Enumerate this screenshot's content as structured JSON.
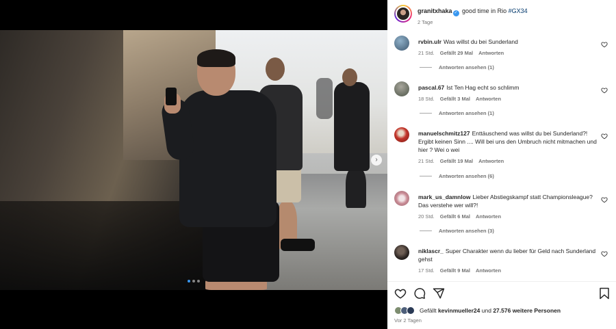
{
  "post": {
    "username": "granitxhaka",
    "caption_text": "good time in Rio",
    "hashtag": "#GX34",
    "age": "2 Tage"
  },
  "carousel": {
    "slide_count": 3,
    "active_slide": 1
  },
  "comments": [
    {
      "user": "rvbin.ulr",
      "text": "Was willst du bei Sunderland",
      "time": "21 Std.",
      "likes": "Gefällt 29 Mal",
      "reply": "Antworten",
      "view_replies": "Antworten ansehen (1)",
      "avatar_color": "#5a7a9a"
    },
    {
      "user": "pascal.67",
      "text": "Ist Ten Hag echt so schlimm",
      "time": "18 Std.",
      "likes": "Gefällt 3 Mal",
      "reply": "Antworten",
      "view_replies": "Antworten ansehen (1)",
      "avatar_color": "#6b7b6a"
    },
    {
      "user": "manuelschmitz127",
      "text": "Enttäuschend was willst du bei Sunderland?! Ergibt keinen Sinn .... Will bei uns den Umbruch nicht mitmachen und hier ? Wei o wei",
      "time": "21 Std.",
      "likes": "Gefällt 19 Mal",
      "reply": "Antworten",
      "view_replies": "Antworten ansehen (6)",
      "avatar_color": "#b24a3a"
    },
    {
      "user": "mark_us_damnlow",
      "text": "Lieber Abstiegskampf statt Championsleague? Das verstehe wer will?!",
      "time": "20 Std.",
      "likes": "Gefällt 6 Mal",
      "reply": "Antworten",
      "view_replies": "Antworten ansehen (3)",
      "avatar_color": "#c9a4a8"
    },
    {
      "user": "niklascr_",
      "text": "Super Charakter wenn du lieber für Geld nach Sunderland gehst",
      "time": "17 Std.",
      "likes": "Gefällt 9 Mal",
      "reply": "Antworten",
      "view_replies": "",
      "avatar_color": "#3a3330"
    }
  ],
  "likes": {
    "prefix": "Gefällt",
    "user": "kevinmueller24",
    "connector": "und",
    "others": "27.576 weitere Personen"
  },
  "date_label": "Vor 2 Tagen",
  "icons": [
    "verified-badge-icon",
    "heart-icon",
    "comment-icon",
    "share-icon",
    "bookmark-icon",
    "chevron-right-icon"
  ],
  "colors": {
    "link": "#00376b",
    "verified": "#3897f0",
    "muted": "#737373"
  }
}
